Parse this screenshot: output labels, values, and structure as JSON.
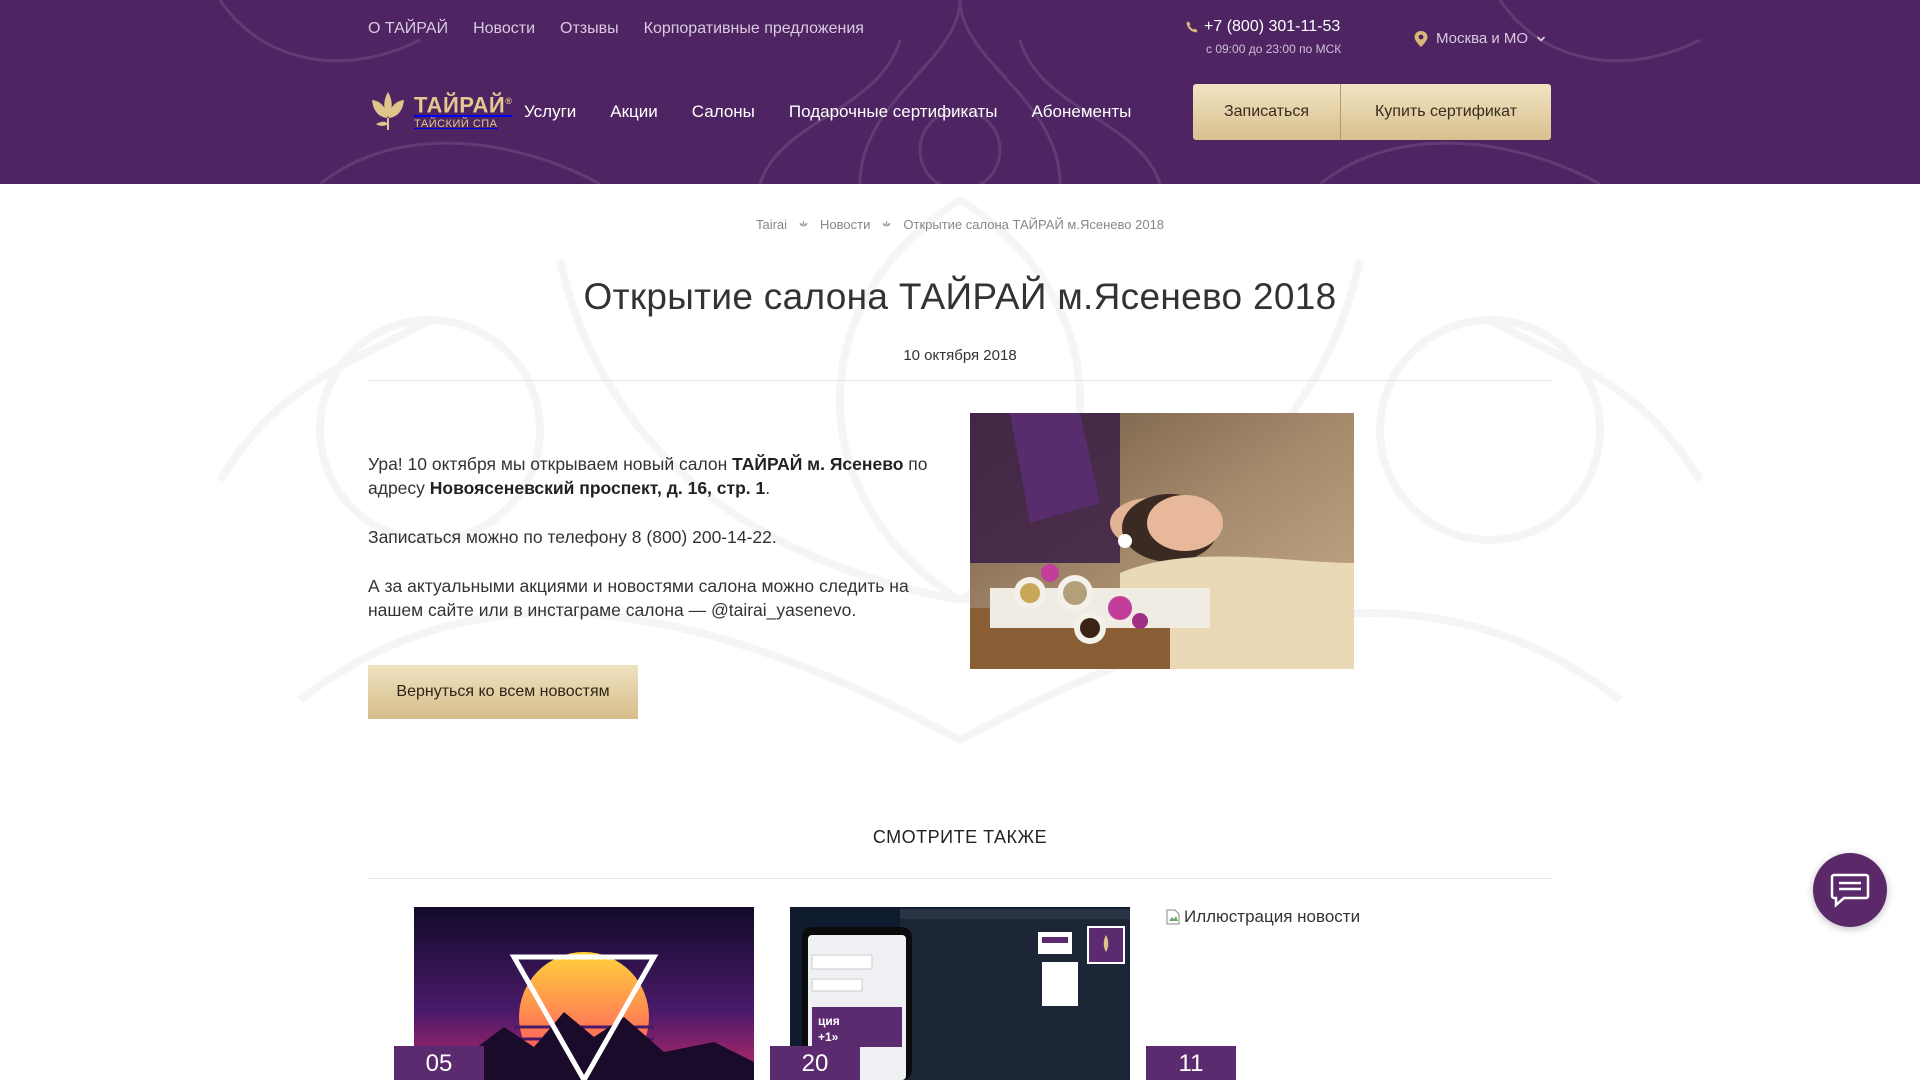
{
  "header": {
    "top_links": [
      "О ТАЙРАЙ",
      "Новости",
      "Отзывы",
      "Корпоративные предложения"
    ],
    "phone": "+7 (800) 301-11-53",
    "hours": "с 09:00 до 23:00 по МСК",
    "city": "Москва и МО",
    "logo_name": "ТАЙРАЙ",
    "logo_reg": "®",
    "logo_sub": "ТАЙСКИЙ СПА",
    "nav": [
      "Услуги",
      "Акции",
      "Салоны",
      "Подарочные сертификаты",
      "Абонементы"
    ],
    "book_label": "Записаться",
    "buy_label": "Купить сертификат"
  },
  "breadcrumb": [
    "Tairai",
    "Новости",
    "Открытие салона ТАЙРАЙ м.Ясенево 2018"
  ],
  "page": {
    "title": "Открытие салона ТАЙРАЙ м.Ясенево 2018",
    "date": "10 октября 2018"
  },
  "article": {
    "p1_a": "Ура! 10 октября мы открываем новый салон ",
    "p1_b1": "ТАЙРАЙ м. Ясенево",
    "p1_c": " по адресу ",
    "p1_b2": "Новоясеневский проспект, д. 16, стр. 1",
    "p1_d": ".",
    "p2": "Записаться можно по телефону 8 (800) 200-14-22.",
    "p3": "А за актуальными акциями и новостями салона можно следить на нашем сайте или в инстаграме салона — @tairai_yasenevo.",
    "back_label": "Вернуться ко всем новостям"
  },
  "see_also": {
    "title": "СМОТРИТЕ ТАКЖЕ",
    "cards": [
      {
        "day": "05"
      },
      {
        "day": "20"
      },
      {
        "day": "11",
        "alt": "Иллюстрация новости"
      }
    ]
  },
  "colors": {
    "header_bg": "#4f2462",
    "gold": "#d8c08e",
    "badge": "#5c2a6e"
  },
  "icons": [
    "phone-icon",
    "location-pin-icon",
    "chevron-down-icon",
    "lotus-logo-icon",
    "breadcrumb-separator-icon",
    "chat-icon",
    "broken-image-icon"
  ]
}
